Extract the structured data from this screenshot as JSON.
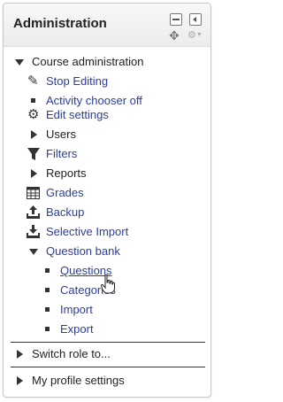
{
  "block": {
    "title": "Administration",
    "dock_icon": "dock-icon",
    "hide_icon": "hide-icon",
    "move_icon": "move-icon",
    "actions_icon": "gear-icon"
  },
  "nav": {
    "course_admin": "Course administration",
    "stop_editing": "Stop Editing",
    "activity_chooser": "Activity chooser off",
    "edit_settings": "Edit settings",
    "users": "Users",
    "filters": "Filters",
    "reports": "Reports",
    "grades": "Grades",
    "backup": "Backup",
    "selective_import": "Selective Import",
    "question_bank": "Question bank",
    "questions": "Questions",
    "categories": "Categories",
    "import": "Import",
    "export": "Export",
    "switch_role": "Switch role to...",
    "my_profile": "My profile settings"
  },
  "colors": {
    "link": "#2c3e9c",
    "text": "#222222"
  }
}
